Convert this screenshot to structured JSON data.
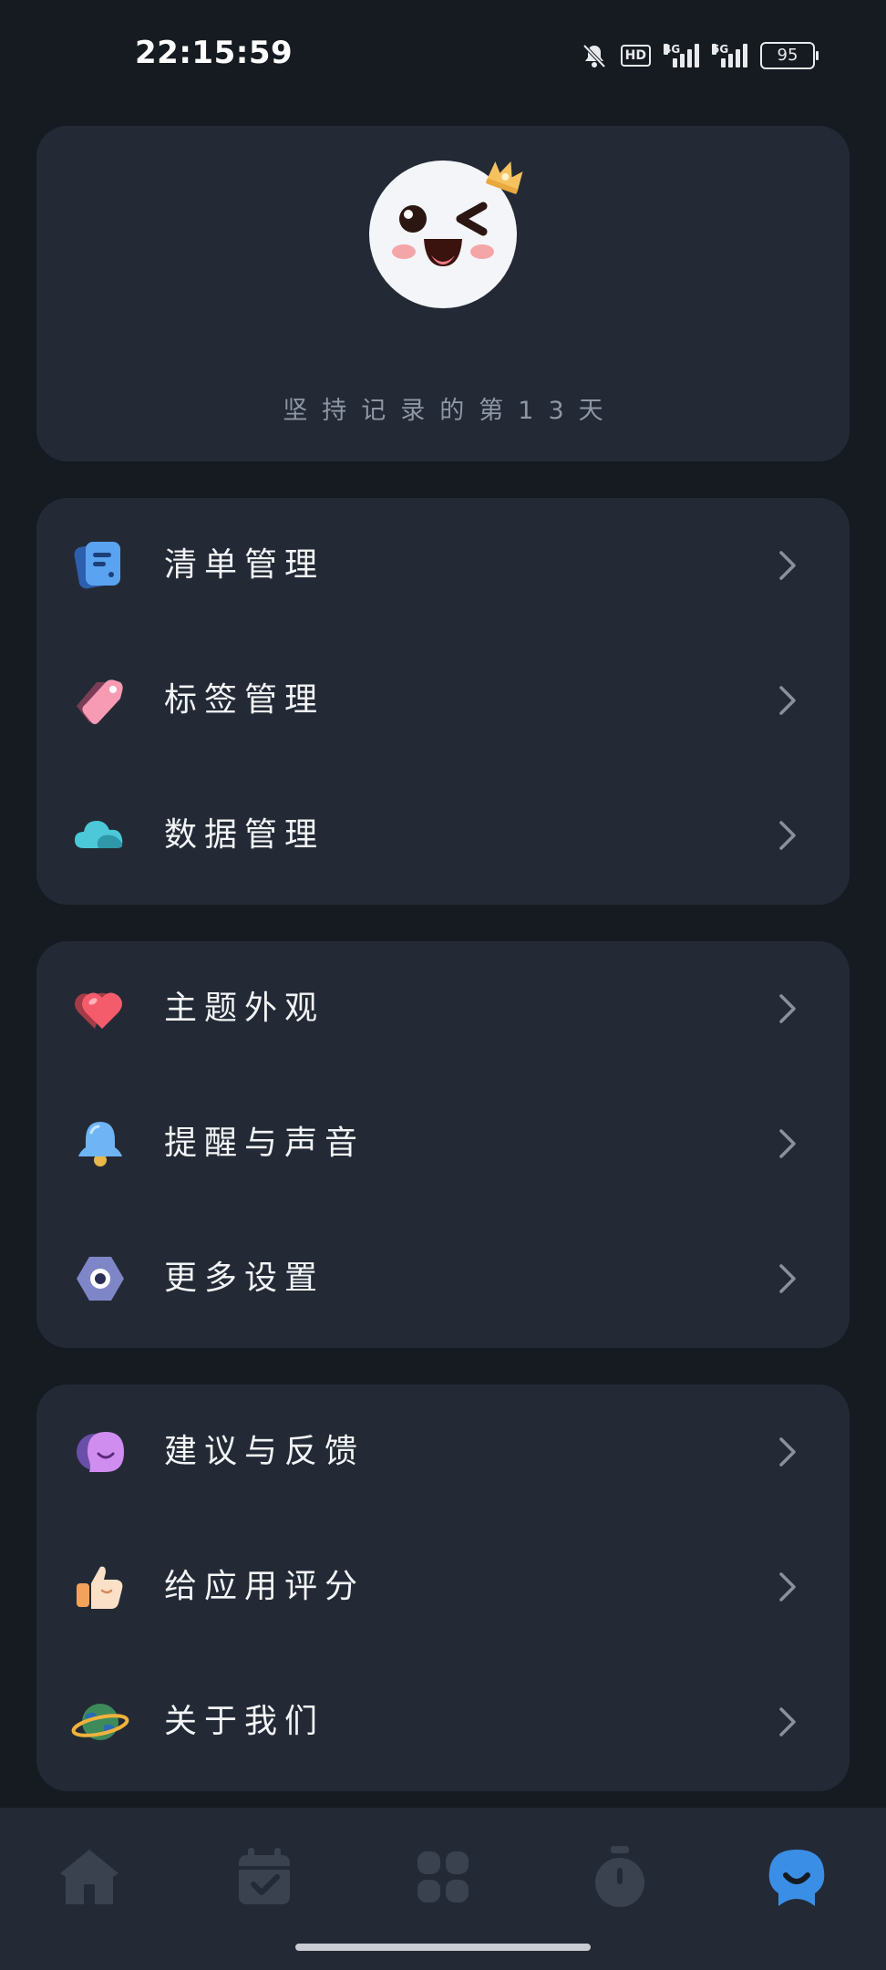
{
  "status_bar": {
    "time": "22:15:59",
    "battery": "95",
    "hd_label": "HD",
    "signal1_label": "4G",
    "signal2_label": "5G"
  },
  "profile": {
    "streak_text": "坚持记录的第13天"
  },
  "groups": [
    {
      "items": [
        {
          "label": "清单管理",
          "icon": "checklist-icon"
        },
        {
          "label": "标签管理",
          "icon": "tag-icon"
        },
        {
          "label": "数据管理",
          "icon": "cloud-icon"
        }
      ]
    },
    {
      "items": [
        {
          "label": "主题外观",
          "icon": "heart-icon"
        },
        {
          "label": "提醒与声音",
          "icon": "bell-icon"
        },
        {
          "label": "更多设置",
          "icon": "hex-nut-icon"
        }
      ]
    },
    {
      "items": [
        {
          "label": "建议与反馈",
          "icon": "chat-bubble-icon"
        },
        {
          "label": "给应用评分",
          "icon": "thumbs-up-icon"
        },
        {
          "label": "关于我们",
          "icon": "planet-icon"
        }
      ]
    }
  ],
  "tab_bar": {
    "tabs": [
      "home-icon",
      "calendar-icon",
      "grid-icon",
      "timer-icon",
      "profile-icon"
    ],
    "active_index": 4,
    "active_color": "#3b8ee6",
    "inactive_color": "#3a4250"
  },
  "colors": {
    "background": "#161b22",
    "card": "#232a35",
    "text": "#f2f4f7",
    "muted": "#8f97a6"
  }
}
